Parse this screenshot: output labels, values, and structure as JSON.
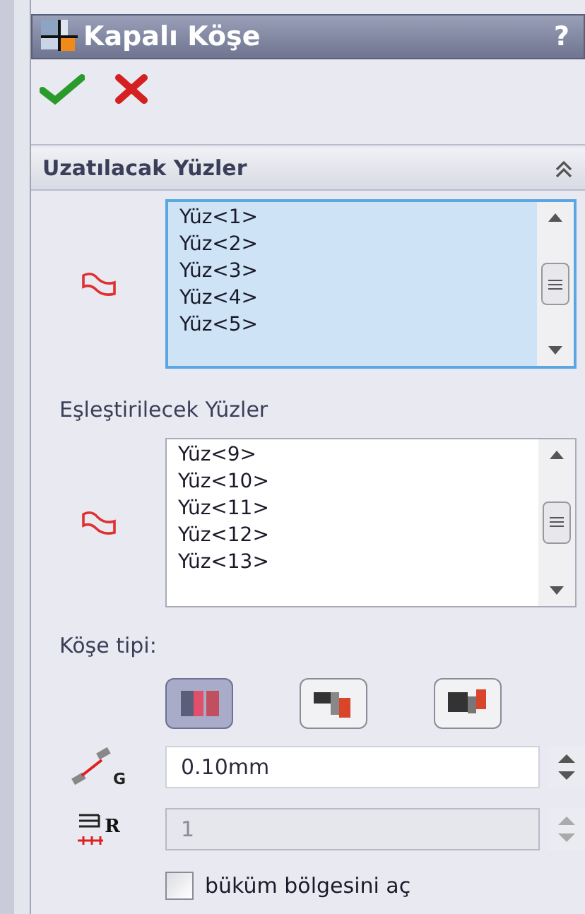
{
  "window": {
    "title": "Kapalı Köşe",
    "help": "?"
  },
  "section": {
    "title": "Uzatılacak Yüzler",
    "expanded": true
  },
  "list_1": {
    "items": [
      "Yüz<1>",
      "Yüz<2>",
      "Yüz<3>",
      "Yüz<4>",
      "Yüz<5>"
    ],
    "active": true
  },
  "list_2_label": "Eşleştirilecek Yüzler",
  "list_2": {
    "items": [
      "Yüz<9>",
      "Yüz<10>",
      "Yüz<11>",
      "Yüz<12>",
      "Yüz<13>"
    ],
    "active": false
  },
  "corner_type_label": "Köşe tipi:",
  "corner_types": [
    {
      "selected": true
    },
    {
      "selected": false
    },
    {
      "selected": false
    }
  ],
  "gap_field": {
    "symbol": "G",
    "value": "0.10mm",
    "disabled": false
  },
  "ratio_field": {
    "symbol": "R",
    "value": "1",
    "disabled": true
  },
  "open_bend_region": {
    "label": "büküm bölgesini aç",
    "checked": false
  }
}
